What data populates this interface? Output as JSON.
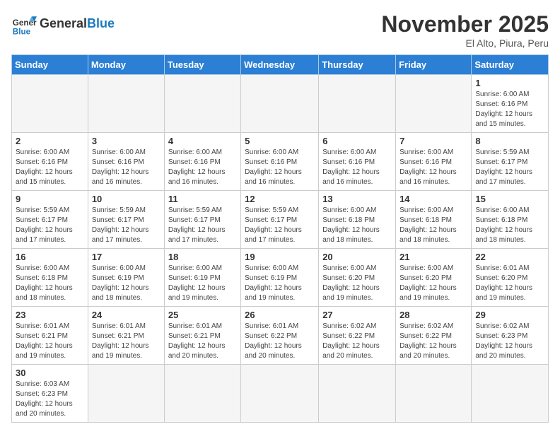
{
  "header": {
    "logo_general": "General",
    "logo_blue": "Blue",
    "month_year": "November 2025",
    "location": "El Alto, Piura, Peru"
  },
  "weekdays": [
    "Sunday",
    "Monday",
    "Tuesday",
    "Wednesday",
    "Thursday",
    "Friday",
    "Saturday"
  ],
  "weeks": [
    [
      {
        "day": "",
        "info": ""
      },
      {
        "day": "",
        "info": ""
      },
      {
        "day": "",
        "info": ""
      },
      {
        "day": "",
        "info": ""
      },
      {
        "day": "",
        "info": ""
      },
      {
        "day": "",
        "info": ""
      },
      {
        "day": "1",
        "info": "Sunrise: 6:00 AM\nSunset: 6:16 PM\nDaylight: 12 hours\nand 15 minutes."
      }
    ],
    [
      {
        "day": "2",
        "info": "Sunrise: 6:00 AM\nSunset: 6:16 PM\nDaylight: 12 hours\nand 15 minutes."
      },
      {
        "day": "3",
        "info": "Sunrise: 6:00 AM\nSunset: 6:16 PM\nDaylight: 12 hours\nand 16 minutes."
      },
      {
        "day": "4",
        "info": "Sunrise: 6:00 AM\nSunset: 6:16 PM\nDaylight: 12 hours\nand 16 minutes."
      },
      {
        "day": "5",
        "info": "Sunrise: 6:00 AM\nSunset: 6:16 PM\nDaylight: 12 hours\nand 16 minutes."
      },
      {
        "day": "6",
        "info": "Sunrise: 6:00 AM\nSunset: 6:16 PM\nDaylight: 12 hours\nand 16 minutes."
      },
      {
        "day": "7",
        "info": "Sunrise: 6:00 AM\nSunset: 6:16 PM\nDaylight: 12 hours\nand 16 minutes."
      },
      {
        "day": "8",
        "info": "Sunrise: 5:59 AM\nSunset: 6:17 PM\nDaylight: 12 hours\nand 17 minutes."
      }
    ],
    [
      {
        "day": "9",
        "info": "Sunrise: 5:59 AM\nSunset: 6:17 PM\nDaylight: 12 hours\nand 17 minutes."
      },
      {
        "day": "10",
        "info": "Sunrise: 5:59 AM\nSunset: 6:17 PM\nDaylight: 12 hours\nand 17 minutes."
      },
      {
        "day": "11",
        "info": "Sunrise: 5:59 AM\nSunset: 6:17 PM\nDaylight: 12 hours\nand 17 minutes."
      },
      {
        "day": "12",
        "info": "Sunrise: 5:59 AM\nSunset: 6:17 PM\nDaylight: 12 hours\nand 17 minutes."
      },
      {
        "day": "13",
        "info": "Sunrise: 6:00 AM\nSunset: 6:18 PM\nDaylight: 12 hours\nand 18 minutes."
      },
      {
        "day": "14",
        "info": "Sunrise: 6:00 AM\nSunset: 6:18 PM\nDaylight: 12 hours\nand 18 minutes."
      },
      {
        "day": "15",
        "info": "Sunrise: 6:00 AM\nSunset: 6:18 PM\nDaylight: 12 hours\nand 18 minutes."
      }
    ],
    [
      {
        "day": "16",
        "info": "Sunrise: 6:00 AM\nSunset: 6:18 PM\nDaylight: 12 hours\nand 18 minutes."
      },
      {
        "day": "17",
        "info": "Sunrise: 6:00 AM\nSunset: 6:19 PM\nDaylight: 12 hours\nand 18 minutes."
      },
      {
        "day": "18",
        "info": "Sunrise: 6:00 AM\nSunset: 6:19 PM\nDaylight: 12 hours\nand 19 minutes."
      },
      {
        "day": "19",
        "info": "Sunrise: 6:00 AM\nSunset: 6:19 PM\nDaylight: 12 hours\nand 19 minutes."
      },
      {
        "day": "20",
        "info": "Sunrise: 6:00 AM\nSunset: 6:20 PM\nDaylight: 12 hours\nand 19 minutes."
      },
      {
        "day": "21",
        "info": "Sunrise: 6:00 AM\nSunset: 6:20 PM\nDaylight: 12 hours\nand 19 minutes."
      },
      {
        "day": "22",
        "info": "Sunrise: 6:01 AM\nSunset: 6:20 PM\nDaylight: 12 hours\nand 19 minutes."
      }
    ],
    [
      {
        "day": "23",
        "info": "Sunrise: 6:01 AM\nSunset: 6:21 PM\nDaylight: 12 hours\nand 19 minutes."
      },
      {
        "day": "24",
        "info": "Sunrise: 6:01 AM\nSunset: 6:21 PM\nDaylight: 12 hours\nand 19 minutes."
      },
      {
        "day": "25",
        "info": "Sunrise: 6:01 AM\nSunset: 6:21 PM\nDaylight: 12 hours\nand 20 minutes."
      },
      {
        "day": "26",
        "info": "Sunrise: 6:01 AM\nSunset: 6:22 PM\nDaylight: 12 hours\nand 20 minutes."
      },
      {
        "day": "27",
        "info": "Sunrise: 6:02 AM\nSunset: 6:22 PM\nDaylight: 12 hours\nand 20 minutes."
      },
      {
        "day": "28",
        "info": "Sunrise: 6:02 AM\nSunset: 6:22 PM\nDaylight: 12 hours\nand 20 minutes."
      },
      {
        "day": "29",
        "info": "Sunrise: 6:02 AM\nSunset: 6:23 PM\nDaylight: 12 hours\nand 20 minutes."
      }
    ],
    [
      {
        "day": "30",
        "info": "Sunrise: 6:03 AM\nSunset: 6:23 PM\nDaylight: 12 hours\nand 20 minutes."
      },
      {
        "day": "",
        "info": ""
      },
      {
        "day": "",
        "info": ""
      },
      {
        "day": "",
        "info": ""
      },
      {
        "day": "",
        "info": ""
      },
      {
        "day": "",
        "info": ""
      },
      {
        "day": "",
        "info": ""
      }
    ]
  ]
}
